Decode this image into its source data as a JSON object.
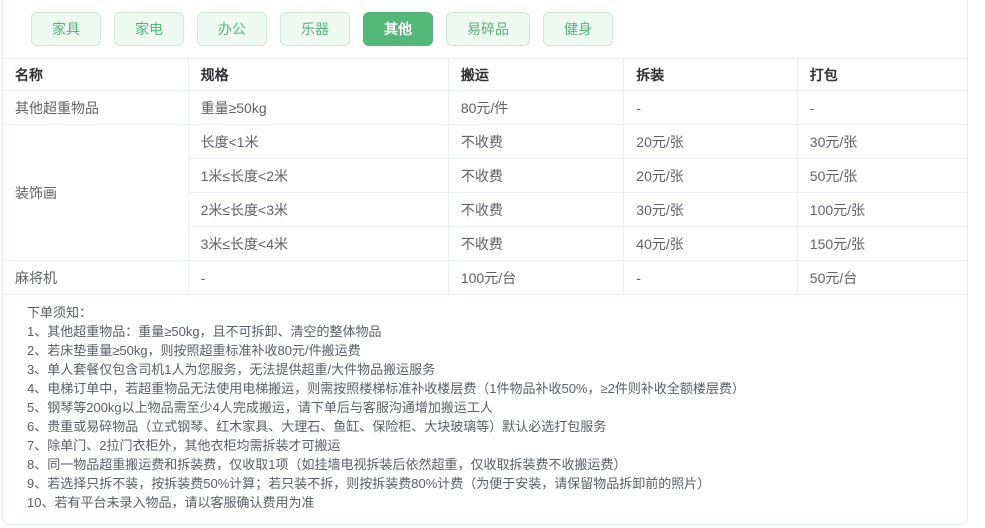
{
  "colors": {
    "accent_green": "#53b878",
    "tab_inactive_bg": "#eef9f2",
    "tab_inactive_border": "#cde9d6",
    "table_border": "#ebeef5",
    "header_text": "#303133",
    "cell_text": "#606266"
  },
  "tabs": [
    {
      "label": "家具",
      "active": false
    },
    {
      "label": "家电",
      "active": false
    },
    {
      "label": "办公",
      "active": false
    },
    {
      "label": "乐器",
      "active": false
    },
    {
      "label": "其他",
      "active": true
    },
    {
      "label": "易碎品",
      "active": false
    },
    {
      "label": "健身",
      "active": false
    }
  ],
  "table": {
    "headers": [
      "名称",
      "规格",
      "搬运",
      "拆装",
      "打包"
    ],
    "col_widths": [
      "19.2%",
      "27%",
      "18.2%",
      "18%",
      "17.6%"
    ],
    "rows": [
      {
        "name": "其他超重物品",
        "cells": [
          [
            "重量≥50kg",
            "80元/件",
            "-",
            "-"
          ]
        ]
      },
      {
        "name": "装饰画",
        "cells": [
          [
            "长度<1米",
            "不收费",
            "20元/张",
            "30元/张"
          ],
          [
            "1米≤长度<2米",
            "不收费",
            "20元/张",
            "50元/张"
          ],
          [
            "2米≤长度<3米",
            "不收费",
            "30元/张",
            "100元/张"
          ],
          [
            "3米≤长度<4米",
            "不收费",
            "40元/张",
            "150元/张"
          ]
        ]
      },
      {
        "name": "麻将机",
        "cells": [
          [
            "-",
            "100元/台",
            "-",
            "50元/台"
          ]
        ]
      }
    ]
  },
  "notes": {
    "title": "下单须知：",
    "items": [
      "1、其他超重物品：重量≥50kg，且不可拆卸、清空的整体物品",
      "2、若床垫重量≥50kg，则按照超重标准补收80元/件搬运费",
      "3、单人套餐仅包含司机1人为您服务，无法提供超重/大件物品搬运服务",
      "4、电梯订单中，若超重物品无法使用电梯搬运，则需按照楼梯标准补收楼层费（1件物品补收50%，≥2件则补收全额楼层费）",
      "5、钢琴等200kg以上物品需至少4人完成搬运，请下单后与客服沟通增加搬运工人",
      "6、贵重或易碎物品（立式钢琴、红木家具、大理石、鱼缸、保险柜、大块玻璃等）默认必选打包服务",
      "7、除单门、2拉门衣柜外，其他衣柜均需拆装才可搬运",
      "8、同一物品超重搬运费和拆装费，仅收取1项（如挂墙电视拆装后依然超重，仅收取拆装费不收搬运费）",
      "9、若选择只拆不装，按拆装费50%计算；若只装不拆，则按拆装费80%计费（为便于安装，请保留物品拆卸前的照片）",
      "10、若有平台未录入物品，请以客服确认费用为准"
    ]
  }
}
